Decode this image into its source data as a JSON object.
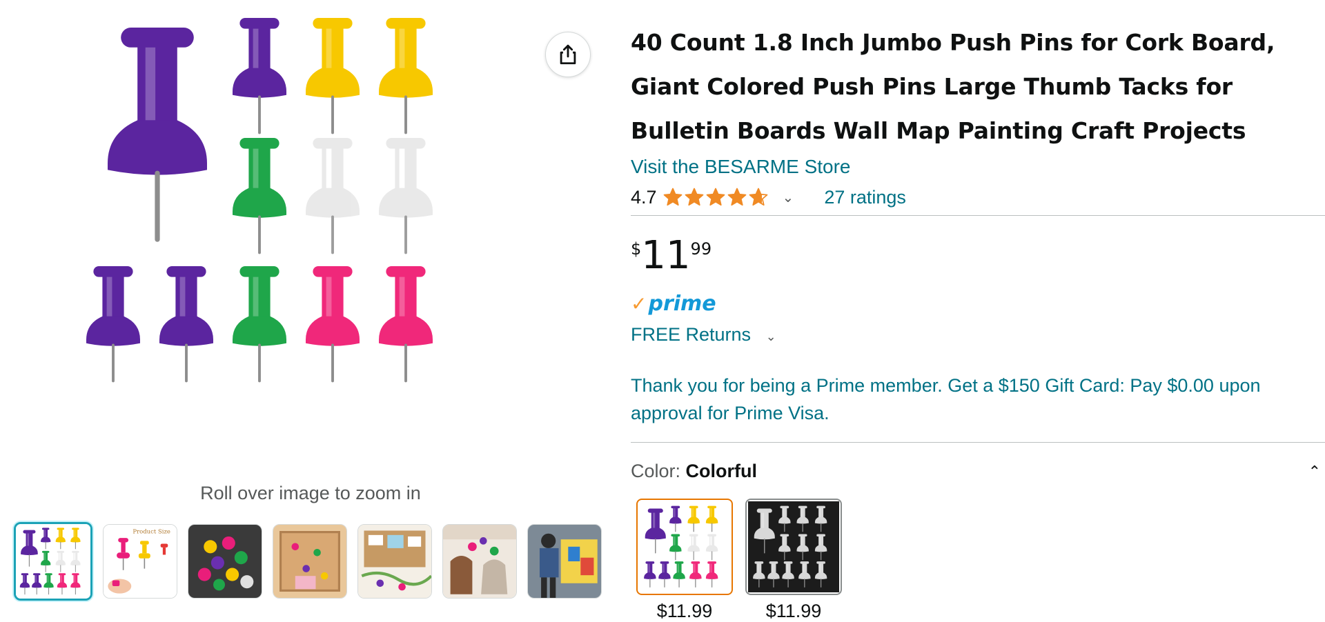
{
  "product": {
    "title": "40 Count 1.8 Inch Jumbo Push Pins for Cork Board, Giant Colored Push Pins Large Thumb Tacks for Bulletin Boards Wall Map Painting Craft Projects",
    "store_link": "Visit the BESARME Store",
    "rating": "4.7",
    "rating_value": 4.7,
    "ratings_count": "27 ratings",
    "price": {
      "symbol": "$",
      "whole": "11",
      "fraction": "99"
    },
    "prime_label": "prime",
    "returns_label": "FREE Returns",
    "promo_text": "Thank you for being a Prime member. Get a $150 Gift Card: Pay $0.00 upon approval for Prime Visa.",
    "color_label": "Color:",
    "color_value": "Colorful",
    "swatches": [
      {
        "price": "$11.99"
      },
      {
        "price": "$11.99"
      }
    ]
  },
  "gallery": {
    "zoom_hint": "Roll over image to zoom in",
    "thumbnail_text": "Product Size"
  },
  "icons": {
    "share": "share-icon",
    "rating_chevron": "chevron-down-icon",
    "returns_chevron": "chevron-down-icon",
    "collapse": "chevron-up-icon",
    "prime_check": "check-icon"
  },
  "colors": {
    "link": "#007185",
    "star": "#f08a24",
    "prime_blue": "#1399d8",
    "selected_swatch_border": "#e77600",
    "selected_thumb_border": "#1ba2b6"
  }
}
